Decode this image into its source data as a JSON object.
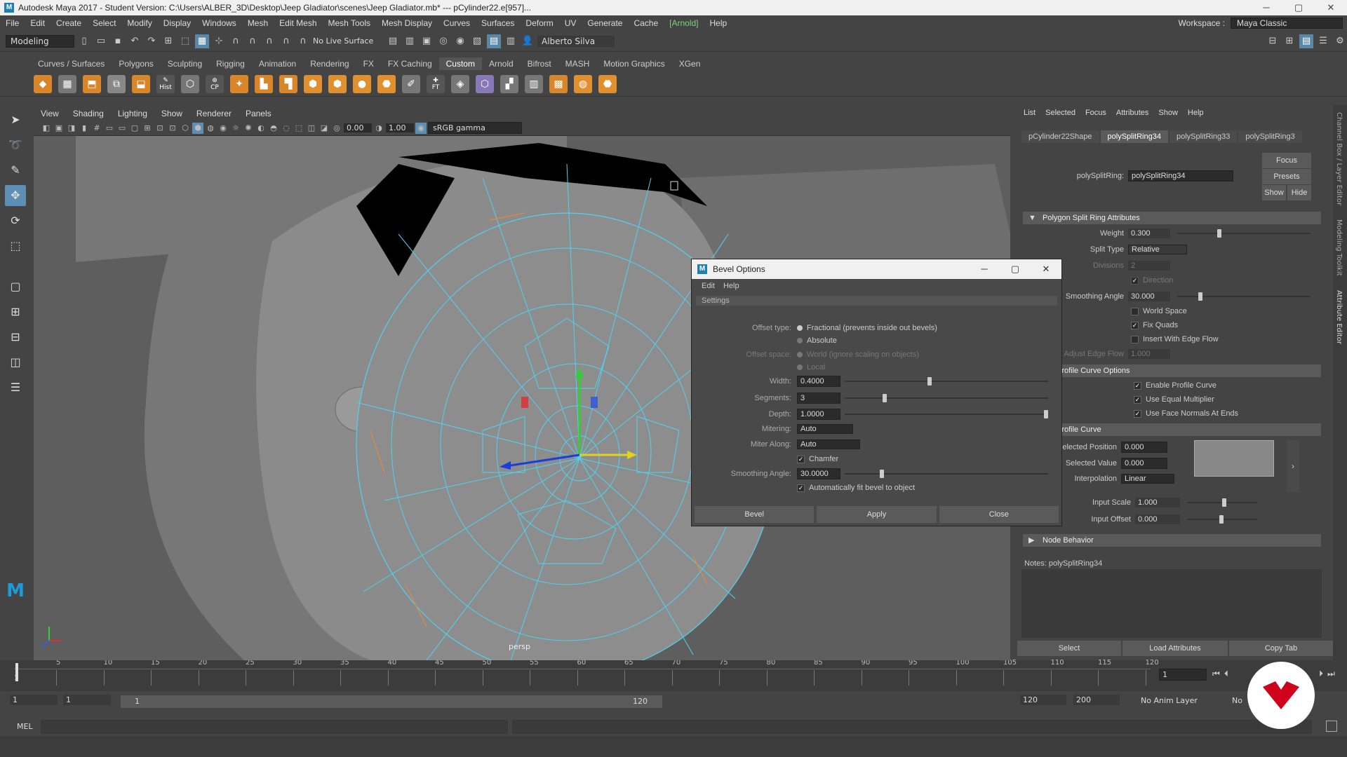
{
  "titlebar": {
    "title": "Autodesk Maya 2017 - Student Version: C:\\Users\\ALBER_3D\\Desktop\\Jeep Gladiator\\scenes\\Jeep Gladiator.mb*   ---   pCylinder22.e[957]...",
    "minimize": "─",
    "maximize": "▢",
    "close": "✕"
  },
  "menubar": {
    "items": [
      "File",
      "Edit",
      "Create",
      "Select",
      "Modify",
      "Display",
      "Windows",
      "Mesh",
      "Edit Mesh",
      "Mesh Tools",
      "Mesh Display",
      "Curves",
      "Surfaces",
      "Deform",
      "UV",
      "Generate",
      "Cache",
      "[Arnold]",
      "Help"
    ],
    "workspace_label": "Workspace :",
    "workspace_value": "Maya Classic"
  },
  "statusline": {
    "menuset": "Modeling",
    "live_surface": "No Live Surface",
    "user": "Alberto Silva"
  },
  "shelf": {
    "tabs": [
      "Curves / Surfaces",
      "Polygons",
      "Sculpting",
      "Rigging",
      "Animation",
      "Rendering",
      "FX",
      "FX Caching",
      "Custom",
      "Arnold",
      "Bifrost",
      "MASH",
      "Motion Graphics",
      "XGen"
    ],
    "active_tab": "Custom",
    "labels": {
      "hist": "Hist",
      "cp": "CP",
      "ft": "FT"
    }
  },
  "viewport": {
    "menu": [
      "View",
      "Shading",
      "Lighting",
      "Show",
      "Renderer",
      "Panels"
    ],
    "field_a": "0.00",
    "field_b": "1.00",
    "colorspace": "sRGB gamma",
    "camera_label": "persp"
  },
  "bevel_dialog": {
    "title": "Bevel Options",
    "menu": [
      "Edit",
      "Help"
    ],
    "frame_title": "Settings",
    "offset_type_label": "Offset type:",
    "offset_type_opt1": "Fractional (prevents inside out bevels)",
    "offset_type_opt2": "Absolute",
    "offset_space_label": "Offset space:",
    "offset_space_opt1": "World (ignore scaling on objects)",
    "offset_space_opt2": "Local",
    "width_label": "Width:",
    "width_value": "0.4000",
    "width_frac": 0.4,
    "segments_label": "Segments:",
    "segments_value": "3",
    "depth_label": "Depth:",
    "depth_value": "1.0000",
    "mitering_label": "Mitering:",
    "mitering_value": "Auto",
    "miter_along_label": "Miter Along:",
    "miter_along_value": "Auto",
    "chamfer_label": "Chamfer",
    "smoothing_label": "Smoothing Angle:",
    "smoothing_value": "30.0000",
    "autofit_label": "Automatically fit bevel to object",
    "buttons": [
      "Bevel",
      "Apply",
      "Close"
    ]
  },
  "attribute_editor": {
    "menu": [
      "List",
      "Selected",
      "Focus",
      "Attributes",
      "Show",
      "Help"
    ],
    "tabs": [
      "pCylinder22Shape",
      "polySplitRing34",
      "polySplitRing33",
      "polySplitRing3"
    ],
    "active_tab": "polySplitRing34",
    "node_label": "polySplitRing:",
    "node_value": "polySplitRing34",
    "focus_btn": "Focus",
    "presets_btn": "Presets",
    "show_btn": "Show",
    "hide_btn": "Hide",
    "section_split": "Polygon Split Ring Attributes",
    "weight_label": "Weight",
    "weight_value": "0.300",
    "split_type_label": "Split Type",
    "split_type_value": "Relative",
    "divisions_label": "Divisions",
    "divisions_value": "2",
    "direction_label": "Direction",
    "smoothing_label": "Smoothing Angle",
    "smoothing_value": "30.000",
    "world_space_label": "World Space",
    "fix_quads_label": "Fix Quads",
    "insert_edge_flow_label": "Insert With Edge Flow",
    "adjust_edge_flow_label": "Adjust Edge Flow",
    "adjust_edge_flow_value": "1.000",
    "section_profile_opts": "Profile Curve Options",
    "enable_profile_label": "Enable Profile Curve",
    "equal_multiplier_label": "Use Equal Multiplier",
    "face_normals_label": "Use Face Normals At Ends",
    "section_profile": "Profile Curve",
    "sel_pos_label": "Selected Position",
    "sel_pos_value": "0.000",
    "sel_val_label": "Selected Value",
    "sel_val_value": "0.000",
    "interp_label": "Interpolation",
    "interp_value": "Linear",
    "input_scale_label": "Input Scale",
    "input_scale_value": "1.000",
    "input_offset_label": "Input Offset",
    "input_offset_value": "0.000",
    "section_node": "Node Behavior",
    "notes_label": "Notes:  polySplitRing34",
    "bottom_buttons": [
      "Select",
      "Load Attributes",
      "Copy Tab"
    ]
  },
  "sidebar_tabs": [
    "Channel Box / Layer Editor",
    "Modeling Toolkit",
    "Attribute Editor"
  ],
  "timeline": {
    "ticks": [
      "5",
      "10",
      "15",
      "20",
      "25",
      "30",
      "35",
      "40",
      "45",
      "50",
      "55",
      "60",
      "65",
      "70",
      "75",
      "80",
      "85",
      "90",
      "95",
      "100",
      "105",
      "110",
      "115",
      "120"
    ],
    "current_frame": "1",
    "frame_field": "1"
  },
  "range": {
    "start": "1",
    "start2": "1",
    "slider_start": "1",
    "slider_end": "120",
    "end": "120",
    "end2": "200",
    "anim_layer": "No Anim Layer",
    "char_set": "No"
  },
  "cmdline": {
    "label": "MEL"
  },
  "colors": {
    "accent": "#5d8fb4",
    "wire": "#4fd2f2",
    "logo": "#d0021b"
  }
}
